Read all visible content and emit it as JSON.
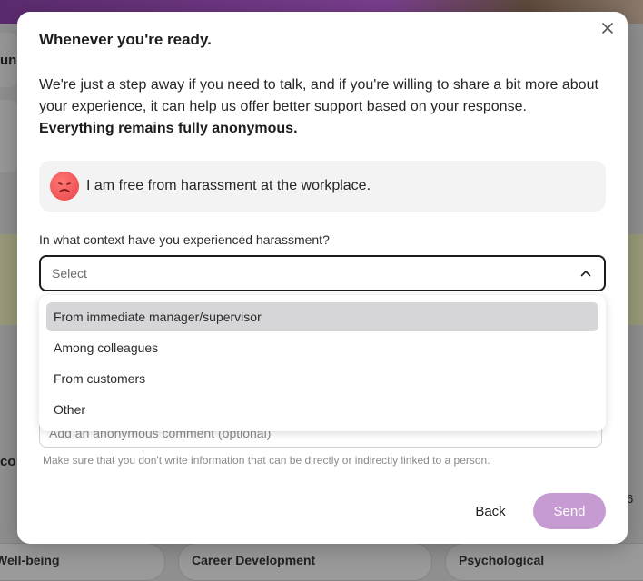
{
  "background": {
    "left_fragment_1": "un",
    "left_fragment_2": "co",
    "right_fragment": "6",
    "bottom_pills": [
      "Well-being",
      "Career Development",
      "Psychological"
    ]
  },
  "modal": {
    "title": "Whenever you're ready.",
    "intro_text": "We're just a step away if you need to talk, and if you're willing to share a bit more about your experience, it can help us offer better support based on your response.",
    "intro_bold": "Everything remains fully anonymous.",
    "statement": "I am free from harassment at the workplace.",
    "question": "In what context have you experienced harassment?",
    "select_placeholder": "Select",
    "options": [
      "From immediate manager/supervisor",
      "Among colleagues",
      "From customers",
      "Other"
    ],
    "highlighted_option": "From immediate manager/supervisor",
    "comment_placeholder": "Add an anonymous comment (optional)",
    "comment_hint": "Make sure that you don't write information that can be directly or indirectly linked to a person.",
    "back_label": "Back",
    "send_label": "Send"
  },
  "colors": {
    "send_button": "#c69bd2",
    "emoji_face": "#e84545",
    "highlight": "#d6d6d8"
  },
  "icons": {
    "close": "close-icon",
    "chevron": "chevron-up-icon",
    "emoji": "sad-face-icon"
  }
}
